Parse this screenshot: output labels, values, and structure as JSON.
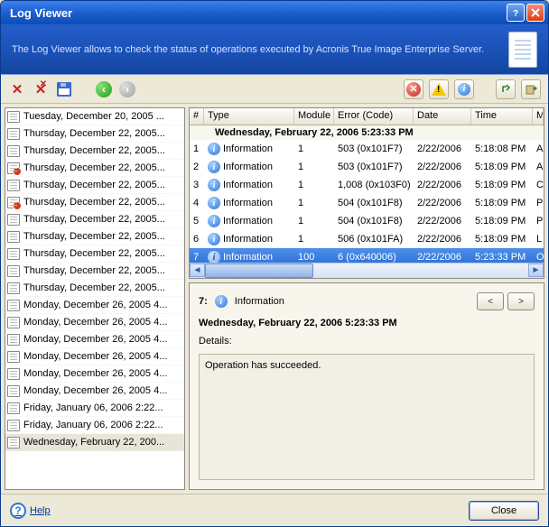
{
  "window": {
    "title": "Log Viewer",
    "description": "The Log Viewer allows to check the status of operations executed by Acronis True Image Enterprise Server."
  },
  "left_dates": [
    {
      "label": "Tuesday, December 20, 2005 ...",
      "error": false
    },
    {
      "label": "Thursday, December 22, 2005...",
      "error": false
    },
    {
      "label": "Thursday, December 22, 2005...",
      "error": false
    },
    {
      "label": "Thursday, December 22, 2005...",
      "error": true
    },
    {
      "label": "Thursday, December 22, 2005...",
      "error": false
    },
    {
      "label": "Thursday, December 22, 2005...",
      "error": true
    },
    {
      "label": "Thursday, December 22, 2005...",
      "error": false
    },
    {
      "label": "Thursday, December 22, 2005...",
      "error": false
    },
    {
      "label": "Thursday, December 22, 2005...",
      "error": false
    },
    {
      "label": "Thursday, December 22, 2005...",
      "error": false
    },
    {
      "label": "Thursday, December 22, 2005...",
      "error": false
    },
    {
      "label": "Monday, December 26, 2005 4...",
      "error": false
    },
    {
      "label": "Monday, December 26, 2005 4...",
      "error": false
    },
    {
      "label": "Monday, December 26, 2005 4...",
      "error": false
    },
    {
      "label": "Monday, December 26, 2005 4...",
      "error": false
    },
    {
      "label": "Monday, December 26, 2005 4...",
      "error": false
    },
    {
      "label": "Monday, December 26, 2005 4...",
      "error": false
    },
    {
      "label": "Friday, January 06, 2006 2:22...",
      "error": false
    },
    {
      "label": "Friday, January 06, 2006 2:22...",
      "error": false
    },
    {
      "label": "Wednesday, February 22, 200...",
      "error": false,
      "selected": true
    }
  ],
  "grid": {
    "columns": {
      "num": "#",
      "type": "Type",
      "module": "Module",
      "error": "Error (Code)",
      "date": "Date",
      "time": "Time",
      "msg": "M"
    },
    "group": "Wednesday, February 22, 2006 5:23:33 PM",
    "rows": [
      {
        "n": "1",
        "type": "Information",
        "module": "1",
        "error": "503 (0x101F7)",
        "date": "2/22/2006",
        "time": "5:18:08 PM",
        "msg": "A"
      },
      {
        "n": "2",
        "type": "Information",
        "module": "1",
        "error": "503 (0x101F7)",
        "date": "2/22/2006",
        "time": "5:18:09 PM",
        "msg": "A"
      },
      {
        "n": "3",
        "type": "Information",
        "module": "1",
        "error": "1,008 (0x103F0)",
        "date": "2/22/2006",
        "time": "5:18:09 PM",
        "msg": "C"
      },
      {
        "n": "4",
        "type": "Information",
        "module": "1",
        "error": "504 (0x101F8)",
        "date": "2/22/2006",
        "time": "5:18:09 PM",
        "msg": "P"
      },
      {
        "n": "5",
        "type": "Information",
        "module": "1",
        "error": "504 (0x101F8)",
        "date": "2/22/2006",
        "time": "5:18:09 PM",
        "msg": "P"
      },
      {
        "n": "6",
        "type": "Information",
        "module": "1",
        "error": "506 (0x101FA)",
        "date": "2/22/2006",
        "time": "5:18:09 PM",
        "msg": "L"
      },
      {
        "n": "7",
        "type": "Information",
        "module": "100",
        "error": "6 (0x640006)",
        "date": "2/22/2006",
        "time": "5:23:33 PM",
        "msg": "O",
        "selected": true
      }
    ]
  },
  "details": {
    "header_num": "7:",
    "header_type": "Information",
    "timestamp": "Wednesday, February 22, 2006 5:23:33 PM",
    "details_label": "Details:",
    "message": "Operation has succeeded.",
    "prev": "<",
    "next": ">"
  },
  "footer": {
    "help": "Help",
    "close": "Close"
  }
}
